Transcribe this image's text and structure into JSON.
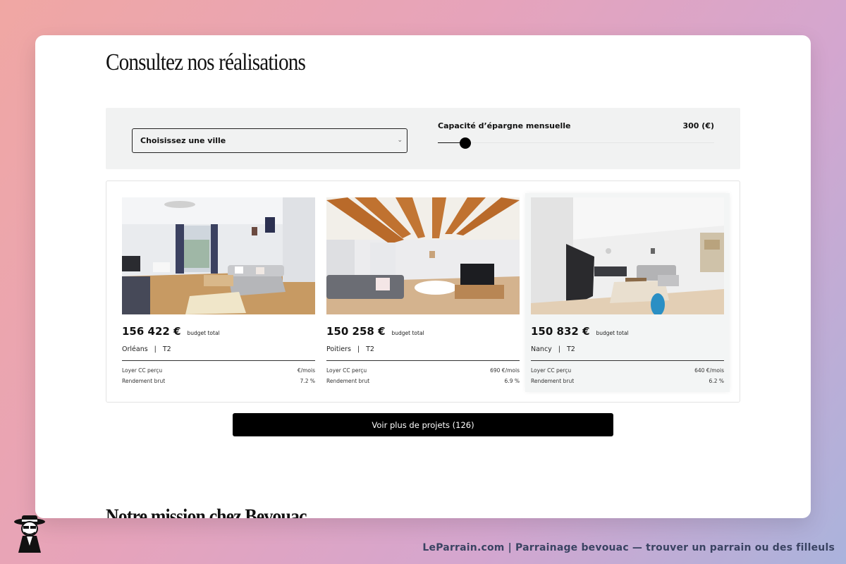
{
  "section": {
    "title": "Consultez nos réalisations",
    "next_title": "Notre mission chez Bevouac"
  },
  "filters": {
    "city_select": {
      "selected": "Choisissez une ville"
    },
    "savings": {
      "label": "Capacité d’épargne mensuelle",
      "value": "300 (€)",
      "level_fraction": 0.1
    }
  },
  "projects": [
    {
      "price": "156 422 €",
      "price_sub": "budget total",
      "city": "Orléans",
      "sep": "|",
      "type": "T2",
      "rent_label": "Loyer CC perçu",
      "rent_value": "€/mois",
      "yield_label": "Rendement brut",
      "yield_value": "7.2 %",
      "image": "living-room-photo-orleans"
    },
    {
      "price": "150 258 €",
      "price_sub": "budget total",
      "city": "Poitiers",
      "sep": "|",
      "type": "T2",
      "rent_label": "Loyer CC perçu",
      "rent_value": "690 €/mois",
      "yield_label": "Rendement brut",
      "yield_value": "6.9 %",
      "image": "living-room-photo-poitiers"
    },
    {
      "price": "150 832 €",
      "price_sub": "budget total",
      "city": "Nancy",
      "sep": "|",
      "type": "T2",
      "rent_label": "Loyer CC perçu",
      "rent_value": "640 €/mois",
      "yield_label": "Rendement brut",
      "yield_value": "6.2 %",
      "image": "living-room-photo-nancy"
    }
  ],
  "more_button": "Voir plus de projets (126)",
  "footer": "LeParrain.com | Parrainage bevouac — trouver un parrain ou des filleuls",
  "icons": {
    "select_chevron": "chevron-down-icon",
    "logo": "detective-mascot-icon"
  },
  "colors": {
    "button": "#000000",
    "filter_bg": "#f1f2f2",
    "footer_text": "#3a4362"
  }
}
